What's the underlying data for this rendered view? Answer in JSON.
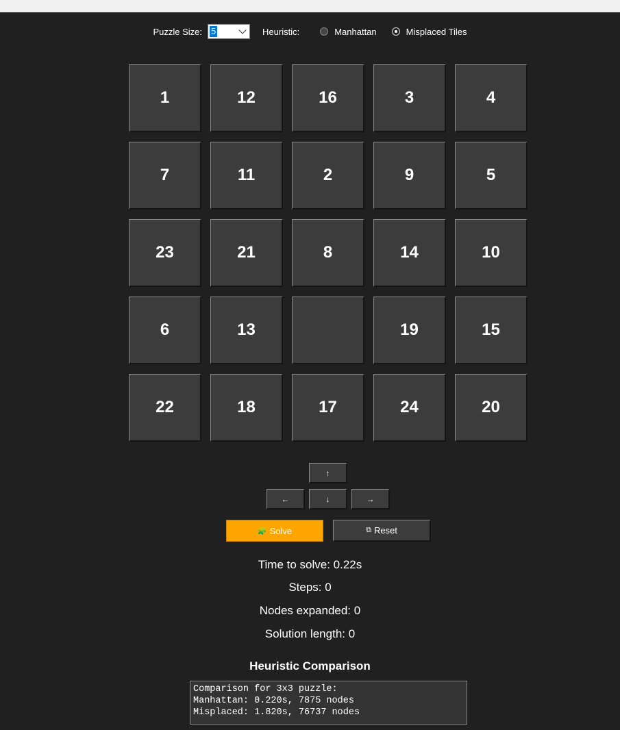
{
  "controls": {
    "size_label": "Puzzle Size:",
    "size_value": "5",
    "heuristic_label": "Heuristic:",
    "options": [
      {
        "label": "Manhattan",
        "checked": false
      },
      {
        "label": "Misplaced Tiles",
        "checked": true
      }
    ]
  },
  "board": {
    "tiles": [
      "1",
      "12",
      "16",
      "3",
      "4",
      "7",
      "11",
      "2",
      "9",
      "5",
      "23",
      "21",
      "8",
      "14",
      "10",
      "6",
      "13",
      "",
      "19",
      "15",
      "22",
      "18",
      "17",
      "24",
      "20"
    ]
  },
  "arrows": {
    "up": "↑",
    "left": "←",
    "down": "↓",
    "right": "→"
  },
  "buttons": {
    "solve": "Solve",
    "reset": "Reset",
    "solve_icon": "🧩",
    "reset_icon": "⧉"
  },
  "stats": {
    "time": "Time to solve: 0.22s",
    "steps": "Steps: 0",
    "nodes": "Nodes expanded: 0",
    "solution": "Solution length: 0"
  },
  "comparison": {
    "title": "Heuristic Comparison",
    "lines": [
      "Comparison for 3x3 puzzle:",
      "Manhattan: 0.220s, 7875 nodes",
      "Misplaced: 1.820s, 76737 nodes"
    ]
  },
  "colors": {
    "accent": "#ffa500",
    "background": "#202020",
    "tile": "#3c3c3c"
  }
}
